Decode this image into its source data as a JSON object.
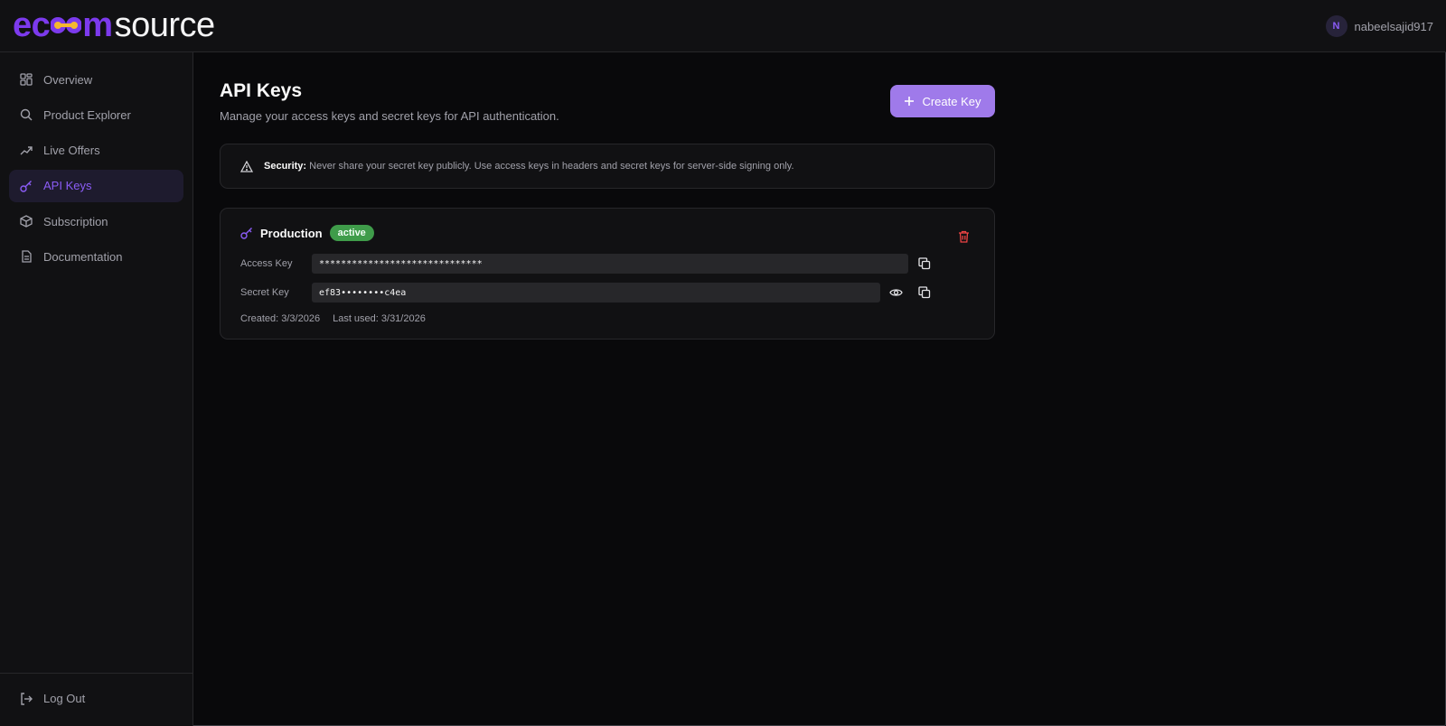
{
  "header": {
    "brand_left": "ec",
    "brand_mid_tail": "m",
    "brand_right": "source",
    "user_initial": "N",
    "username": "nabeelsajid917"
  },
  "sidebar": {
    "items": [
      {
        "label": "Overview",
        "icon": "grid-icon"
      },
      {
        "label": "Product Explorer",
        "icon": "search-icon"
      },
      {
        "label": "Live Offers",
        "icon": "trending-up-icon"
      },
      {
        "label": "API Keys",
        "icon": "key-icon",
        "active": true
      },
      {
        "label": "Subscription",
        "icon": "box-icon"
      },
      {
        "label": "Documentation",
        "icon": "document-icon"
      }
    ],
    "logout_label": "Log Out"
  },
  "main": {
    "title": "API Keys",
    "subtitle": "Manage your access keys and secret keys for API authentication.",
    "create_button": "Create Key",
    "security_label": "Security:",
    "security_text": "Never share your secret key publicly. Use access keys in headers and secret keys for server-side signing only.",
    "key": {
      "name": "Production",
      "status": "active",
      "access_label": "Access Key",
      "access_value": "******************************",
      "secret_label": "Secret Key",
      "secret_value": "ef83••••••••c4ea",
      "created": "Created: 3/3/2026",
      "last_used": "Last used: 3/31/2026"
    }
  },
  "colors": {
    "accent": "#8b5cf6",
    "button": "#9f7aea",
    "badge": "#3f9c4a",
    "danger": "#ef4444",
    "background": "#09090b"
  }
}
